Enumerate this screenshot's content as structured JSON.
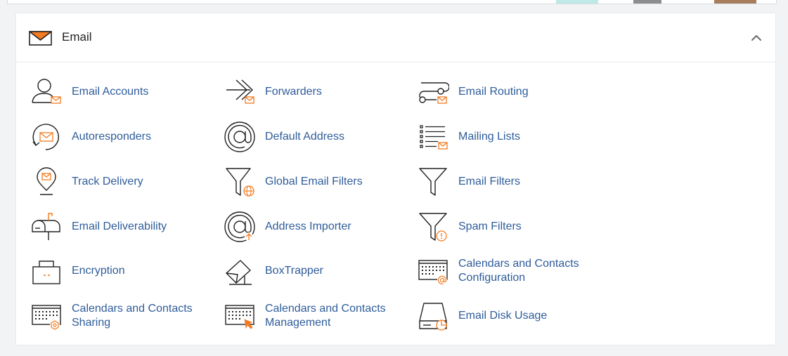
{
  "section": {
    "title": "Email",
    "icon": "envelope-icon",
    "collapse_icon": "chevron-up-icon"
  },
  "colors": {
    "link": "#2e5c9a",
    "accent": "#f47b20",
    "icon_stroke": "#222222"
  },
  "items": [
    {
      "label": "Email Accounts",
      "icon": "user-mail-icon"
    },
    {
      "label": "Forwarders",
      "icon": "forward-arrow-icon"
    },
    {
      "label": "Email Routing",
      "icon": "routing-icon"
    },
    {
      "label": "Autoresponders",
      "icon": "autoresponder-icon"
    },
    {
      "label": "Default Address",
      "icon": "at-sign-icon"
    },
    {
      "label": "Mailing Lists",
      "icon": "list-mail-icon"
    },
    {
      "label": "Track Delivery",
      "icon": "location-pin-icon"
    },
    {
      "label": "Global Email Filters",
      "icon": "funnel-globe-icon"
    },
    {
      "label": "Email Filters",
      "icon": "funnel-icon"
    },
    {
      "label": "Email Deliverability",
      "icon": "mailbox-icon"
    },
    {
      "label": "Address Importer",
      "icon": "at-import-icon"
    },
    {
      "label": "Spam Filters",
      "icon": "funnel-warning-icon"
    },
    {
      "label": "Encryption",
      "icon": "lock-icon"
    },
    {
      "label": "BoxTrapper",
      "icon": "trap-icon"
    },
    {
      "label": "Calendars and Contacts Configuration",
      "icon": "calendar-at-icon"
    },
    {
      "label": "Calendars and Contacts Sharing",
      "icon": "calendar-gear-icon"
    },
    {
      "label": "Calendars and Contacts Management",
      "icon": "calendar-pointer-icon"
    },
    {
      "label": "Email Disk Usage",
      "icon": "disk-usage-icon"
    }
  ]
}
